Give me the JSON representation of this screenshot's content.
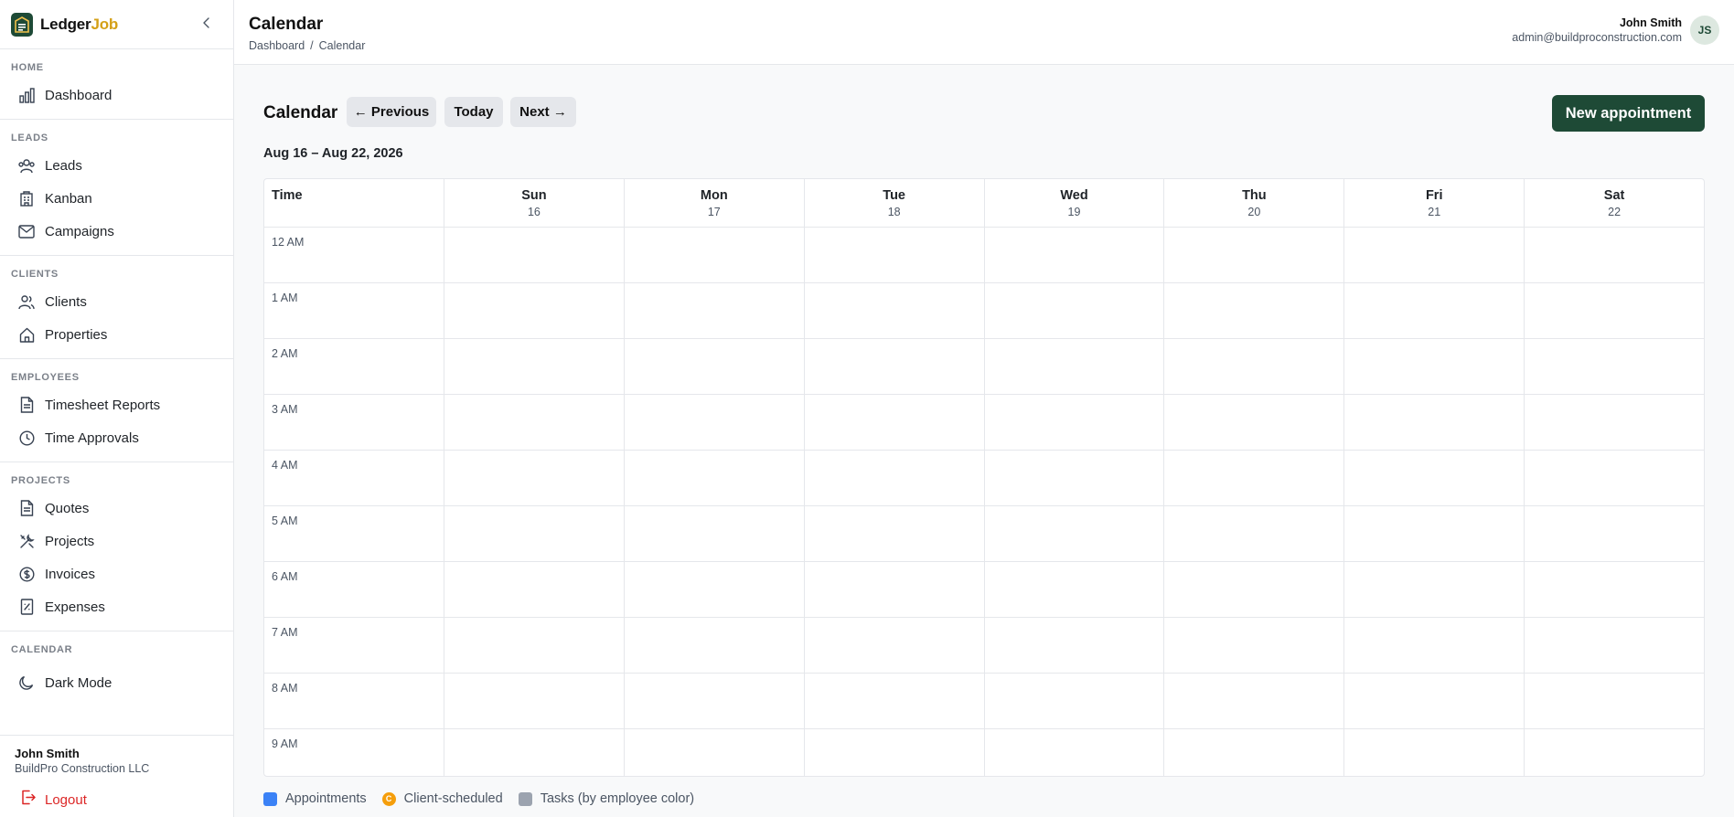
{
  "brand": {
    "name_part1": "Ledger",
    "name_part2": "Job"
  },
  "sidebar": {
    "sections": [
      {
        "heading": "HOME",
        "items": [
          {
            "label": "Dashboard",
            "icon": "bar-chart-icon"
          }
        ]
      },
      {
        "heading": "LEADS",
        "items": [
          {
            "label": "Leads",
            "icon": "users-icon"
          },
          {
            "label": "Kanban",
            "icon": "building-icon"
          },
          {
            "label": "Campaigns",
            "icon": "mail-icon"
          }
        ]
      },
      {
        "heading": "CLIENTS",
        "items": [
          {
            "label": "Clients",
            "icon": "user-group-icon"
          },
          {
            "label": "Properties",
            "icon": "home-icon"
          }
        ]
      },
      {
        "heading": "EMPLOYEES",
        "items": [
          {
            "label": "Timesheet Reports",
            "icon": "document-icon"
          },
          {
            "label": "Time Approvals",
            "icon": "clock-icon"
          }
        ]
      },
      {
        "heading": "PROJECTS",
        "items": [
          {
            "label": "Quotes",
            "icon": "document-icon"
          },
          {
            "label": "Projects",
            "icon": "tools-icon"
          },
          {
            "label": "Invoices",
            "icon": "dollar-icon"
          },
          {
            "label": "Expenses",
            "icon": "receipt-icon"
          }
        ]
      },
      {
        "heading": "CALENDAR",
        "items": [
          {
            "label": "Dark Mode",
            "icon": "moon-icon"
          }
        ]
      }
    ],
    "footer": {
      "name": "John Smith",
      "company": "BuildPro Construction LLC",
      "logout_label": "Logout"
    }
  },
  "header": {
    "title": "Calendar",
    "breadcrumb": {
      "home": "Dashboard",
      "sep": "/",
      "current": "Calendar"
    },
    "user": {
      "name": "John Smith",
      "email": "admin@buildproconstruction.com",
      "initials": "JS"
    }
  },
  "toolbar": {
    "heading": "Calendar",
    "prev_label": "← Previous",
    "today_label": "Today",
    "next_label": "Next →",
    "new_label": "New appointment"
  },
  "range_label": "Aug 16 – Aug 22, 2026",
  "calendar": {
    "time_header": "Time",
    "days": [
      {
        "name": "Sun",
        "num": "16"
      },
      {
        "name": "Mon",
        "num": "17"
      },
      {
        "name": "Tue",
        "num": "18"
      },
      {
        "name": "Wed",
        "num": "19"
      },
      {
        "name": "Thu",
        "num": "20"
      },
      {
        "name": "Fri",
        "num": "21"
      },
      {
        "name": "Sat",
        "num": "22"
      }
    ],
    "hours": [
      "12 AM",
      "1 AM",
      "2 AM",
      "3 AM",
      "4 AM",
      "5 AM",
      "6 AM",
      "7 AM",
      "8 AM",
      "9 AM"
    ]
  },
  "legend": {
    "appointments": "Appointments",
    "client_scheduled": "Client-scheduled",
    "client_scheduled_badge": "C",
    "tasks": "Tasks (by employee color)"
  },
  "colors": {
    "brand": "#1e4a36",
    "brand_accent": "#d4a017",
    "appointments": "#3b82f6",
    "client_scheduled": "#f59e0b",
    "tasks": "#9ca3af",
    "logout": "#dc2626"
  }
}
